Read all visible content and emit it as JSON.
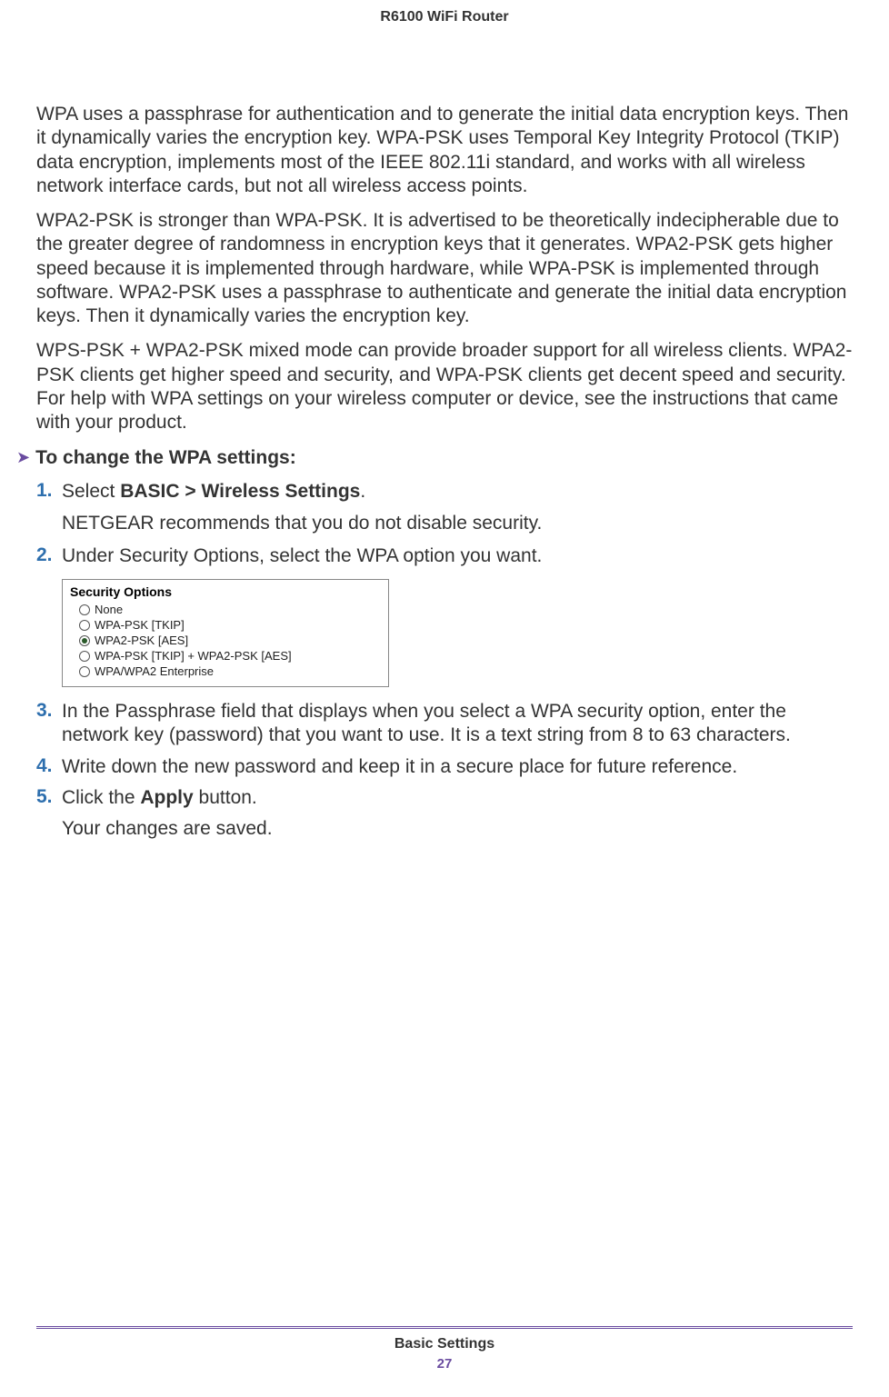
{
  "header": "R6100 WiFi Router",
  "paragraphs": {
    "p1": "WPA uses a passphrase for authentication and to generate the initial data encryption keys. Then it dynamically varies the encryption key. WPA-PSK uses Temporal Key Integrity Protocol (TKIP) data encryption, implements most of the IEEE 802.11i standard, and works with all wireless network interface cards, but not all wireless access points.",
    "p2": "WPA2-PSK is stronger than WPA-PSK. It is advertised to be theoretically indecipherable due to the greater degree of randomness in encryption keys that it generates. WPA2-PSK gets higher speed because it is implemented through hardware, while WPA-PSK is implemented through software. WPA2-PSK uses a passphrase to authenticate and generate the initial data encryption keys. Then it dynamically varies the encryption key.",
    "p3": "WPS-PSK + WPA2-PSK mixed mode can provide broader support for all wireless clients. WPA2-PSK clients get higher speed and security, and WPA-PSK clients get decent speed and security. For help with WPA settings on your wireless computer or device, see the instructions that came with your product."
  },
  "procedure": {
    "arrow": "➤",
    "title": "To change the WPA settings:"
  },
  "steps": {
    "s1": {
      "num": "1.",
      "prefix": "Select ",
      "bold": "BASIC > Wireless Settings",
      "suffix": "."
    },
    "s1_sub": "NETGEAR recommends that you do not disable security",
    "s1_sub_suffix": ".",
    "s2": {
      "num": "2.",
      "text": "Under Security Options, select the WPA option you want."
    },
    "s3": {
      "num": "3.",
      "text": "In the Passphrase field that displays when you select a WPA security option, enter the network key (password) that you want to use. It is a text string from 8 to 63 characters."
    },
    "s4": {
      "num": "4.",
      "text": "Write down the new password and keep it in a secure place for future reference."
    },
    "s5": {
      "num": "5.",
      "prefix": "Click the ",
      "bold": "Apply",
      "suffix": " button."
    },
    "s5_sub": "Your changes are saved."
  },
  "security_options": {
    "title": "Security Options",
    "options": {
      "o1": "None",
      "o2": "WPA-PSK [TKIP]",
      "o3": "WPA2-PSK [AES]",
      "o4": "WPA-PSK [TKIP] + WPA2-PSK [AES]",
      "o5": "WPA/WPA2 Enterprise"
    },
    "selected_index": 2
  },
  "footer": {
    "section": "Basic Settings",
    "page": "27"
  }
}
